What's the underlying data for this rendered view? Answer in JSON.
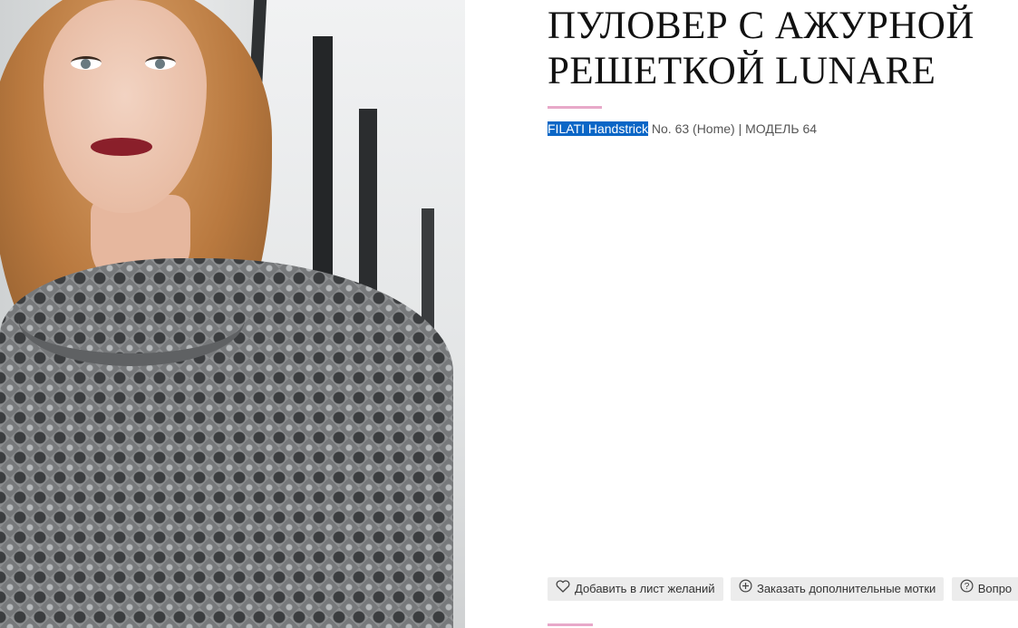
{
  "product": {
    "title_line1": "ПУЛОВЕР С АЖУРНОЙ",
    "title_line2": "РЕШЕТКОЙ LUNARE",
    "brand": "FILATI Handstrick",
    "issue": " No. 63 (Home) | МОДЕЛЬ 64"
  },
  "actions": {
    "wishlist_label": "Добавить в лист желаний",
    "wishlist_icon": "heart-icon",
    "order_label": "Заказать дополнительные мотки",
    "order_icon": "plus-circle-icon",
    "question_label": "Вопро",
    "question_icon": "question-circle-icon"
  },
  "colors": {
    "accent": "#e8a9c9",
    "selection": "#0a66c6",
    "button_bg": "#ececec"
  }
}
